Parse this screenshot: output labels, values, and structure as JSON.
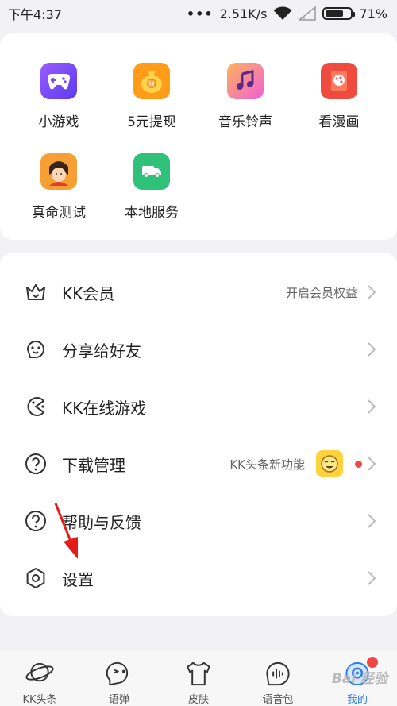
{
  "status_bar": {
    "time": "下午4:37",
    "dots": "•••",
    "speed": "2.51K/s",
    "battery": "71%",
    "battery_level": 0.71
  },
  "grid": [
    {
      "label": "小游戏",
      "icon": "gamepad-icon",
      "color": "#7a4cf5"
    },
    {
      "label": "5元提现",
      "icon": "money-bag-icon",
      "color": "#ffb21e"
    },
    {
      "label": "音乐铃声",
      "icon": "music-note-icon",
      "color": "#f58fd2"
    },
    {
      "label": "看漫画",
      "icon": "comic-book-icon",
      "color": "#f25a4a"
    },
    {
      "label": "真命测试",
      "icon": "fortune-girl-icon",
      "color": "#f08a2d"
    },
    {
      "label": "本地服务",
      "icon": "truck-icon",
      "color": "#2fc17a"
    }
  ],
  "list": [
    {
      "title": "KK会员",
      "sub": "开启会员权益",
      "icon": "crown-icon"
    },
    {
      "title": "分享给好友",
      "sub": "",
      "icon": "share-icon"
    },
    {
      "title": "KK在线游戏",
      "sub": "",
      "icon": "online-game-icon"
    },
    {
      "title": "下载管理",
      "sub": "KK头条新功能",
      "icon": "question-icon"
    },
    {
      "title": "帮助与反馈",
      "sub": "",
      "icon": "help-icon"
    },
    {
      "title": "设置",
      "sub": "",
      "icon": "settings-icon"
    }
  ],
  "bottom_nav": [
    {
      "label": "KK头条",
      "icon": "planet-icon"
    },
    {
      "label": "语弹",
      "icon": "chat-face-icon"
    },
    {
      "label": "皮肤",
      "icon": "tshirt-icon"
    },
    {
      "label": "语音包",
      "icon": "voice-pack-icon"
    },
    {
      "label": "我的",
      "icon": "profile-icon",
      "active": true
    }
  ],
  "watermark": "Bai 经验",
  "colors": {
    "accent": "#2d7cf6",
    "red_dot": "#f04646",
    "arrow": "#e81b1b"
  }
}
